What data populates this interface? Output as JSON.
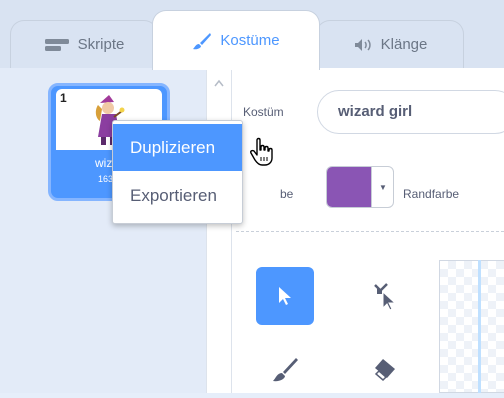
{
  "tabs": [
    {
      "label": "Skripte",
      "icon": "code-blocks-icon",
      "active": false
    },
    {
      "label": "Kostüme",
      "icon": "paintbrush-icon",
      "active": true
    },
    {
      "label": "Klänge",
      "icon": "speaker-icon",
      "active": false
    }
  ],
  "costume_list": {
    "card": {
      "index": "1",
      "name": "wizar",
      "size": "163 x"
    }
  },
  "context_menu": {
    "items": [
      {
        "label": "Duplizieren",
        "highlighted": true
      },
      {
        "label": "Exportieren",
        "highlighted": false
      }
    ]
  },
  "editor": {
    "costume_label": "Kostüm",
    "costume_name": "wizard girl",
    "fill_label": "be",
    "fill_color": "#8a55b4",
    "outline_label": "Randfarbe",
    "tools": [
      "select-tool",
      "reshape-tool",
      "brush-tool",
      "eraser-tool"
    ]
  },
  "colors": {
    "accent": "#4d97ff",
    "tab_bg": "#d9e3f2"
  }
}
